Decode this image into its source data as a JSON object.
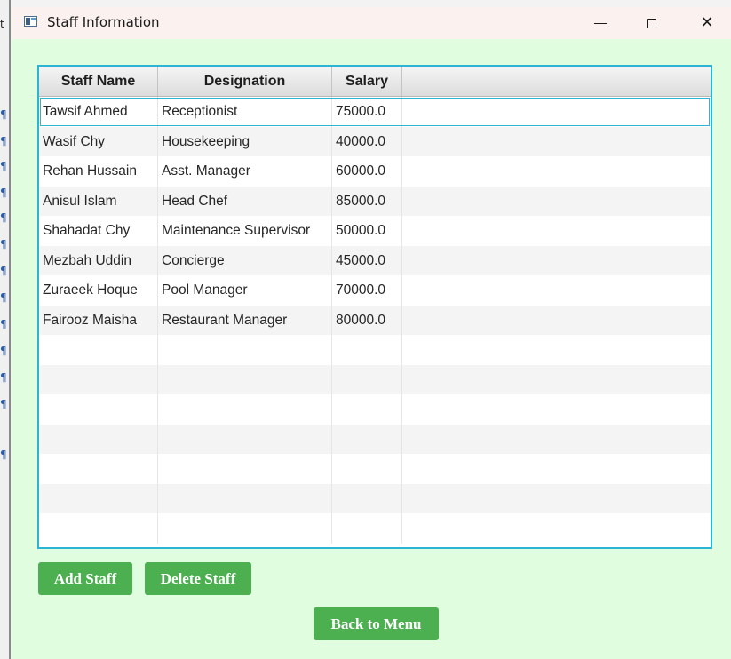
{
  "background": {
    "glyphs": [
      "t",
      "¶",
      "¶",
      "¶",
      "¶",
      "¶",
      "¶",
      "¶",
      "¶",
      "¶",
      "¶",
      "¶",
      "¶",
      "¶"
    ]
  },
  "window": {
    "title": "Staff Information",
    "icon": "app-window-icon",
    "controls": {
      "minimize": "minimize-icon",
      "maximize": "maximize-icon",
      "close": "✕"
    }
  },
  "table": {
    "columns": [
      "Staff Name",
      "Designation",
      "Salary"
    ],
    "rows": [
      [
        "Tawsif Ahmed",
        "Receptionist",
        "75000.0"
      ],
      [
        "Wasif Chy",
        "Housekeeping",
        "40000.0"
      ],
      [
        "Rehan Hussain",
        "Asst. Manager",
        "60000.0"
      ],
      [
        "Anisul Islam",
        "Head Chef",
        "85000.0"
      ],
      [
        "Shahadat Chy",
        "Maintenance Supervisor",
        "50000.0"
      ],
      [
        "Mezbah Uddin",
        "Concierge",
        "45000.0"
      ],
      [
        "Zuraeek Hoque",
        "Pool Manager",
        "70000.0"
      ],
      [
        "Fairooz Maisha",
        "Restaurant Manager",
        "80000.0"
      ]
    ],
    "selected_row": 0,
    "accent_color": "#2ab5d5"
  },
  "buttons": {
    "add_label": "Add Staff",
    "delete_label": "Delete Staff",
    "back_label": "Back to Menu",
    "color": "#4caf50"
  },
  "colors": {
    "window_bg": "#e1fde0",
    "titlebar_bg": "#fbf1ee"
  }
}
